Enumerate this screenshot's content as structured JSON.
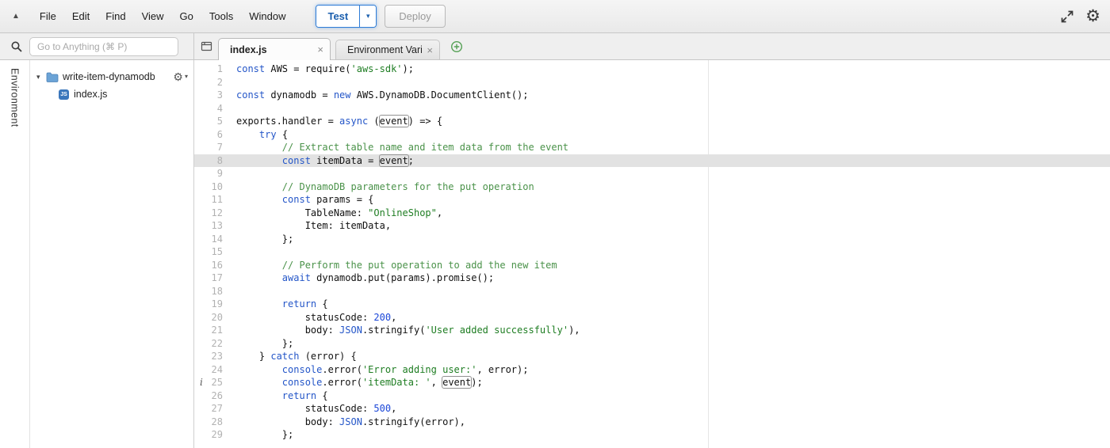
{
  "menubar": {
    "items": [
      "File",
      "Edit",
      "Find",
      "View",
      "Go",
      "Tools",
      "Window"
    ],
    "test_button": "Test",
    "deploy_button": "Deploy"
  },
  "searchbar": {
    "placeholder": "Go to Anything (⌘ P)"
  },
  "tabs": [
    {
      "label": "index.js",
      "active": true
    },
    {
      "label": "Environment Vari",
      "active": false
    }
  ],
  "sidebar": {
    "panel_label": "Environment",
    "folder": {
      "name": "write-item-dynamodb"
    },
    "files": [
      {
        "name": "index.js"
      }
    ]
  },
  "colors": {
    "accent-blue": "#2e7cd6",
    "keyword": "#2456c8",
    "string": "#1e7d22",
    "comment": "#4a9249",
    "number": "#1a46d8",
    "builtin": "#2456c8",
    "plus-green": "#55a055"
  },
  "editor": {
    "active_line": 8,
    "info_line": 25,
    "lines": [
      {
        "n": 1,
        "t": [
          [
            "k",
            "const"
          ],
          [
            "p",
            " AWS = require("
          ],
          [
            "s",
            "'aws-sdk'"
          ],
          [
            "p",
            ");"
          ]
        ]
      },
      {
        "n": 2,
        "t": []
      },
      {
        "n": 3,
        "t": [
          [
            "k",
            "const"
          ],
          [
            "p",
            " dynamodb = "
          ],
          [
            "k",
            "new"
          ],
          [
            "p",
            " AWS.DynamoDB.DocumentClient();"
          ]
        ]
      },
      {
        "n": 4,
        "t": []
      },
      {
        "n": 5,
        "t": [
          [
            "p",
            "exports.handler = "
          ],
          [
            "k",
            "async"
          ],
          [
            "p",
            " ("
          ],
          [
            "e",
            "event"
          ],
          [
            "p",
            ") => {"
          ]
        ]
      },
      {
        "n": 6,
        "t": [
          [
            "p",
            "    "
          ],
          [
            "k",
            "try"
          ],
          [
            "p",
            " {"
          ]
        ]
      },
      {
        "n": 7,
        "t": [
          [
            "p",
            "        "
          ],
          [
            "c",
            "// Extract table name and item data from the event"
          ]
        ]
      },
      {
        "n": 8,
        "t": [
          [
            "p",
            "        "
          ],
          [
            "k",
            "const"
          ],
          [
            "p",
            " itemData = "
          ],
          [
            "e",
            "event"
          ],
          [
            "p",
            ";"
          ]
        ]
      },
      {
        "n": 9,
        "t": []
      },
      {
        "n": 10,
        "t": [
          [
            "p",
            "        "
          ],
          [
            "c",
            "// DynamoDB parameters for the put operation"
          ]
        ]
      },
      {
        "n": 11,
        "t": [
          [
            "p",
            "        "
          ],
          [
            "k",
            "const"
          ],
          [
            "p",
            " params = {"
          ]
        ]
      },
      {
        "n": 12,
        "t": [
          [
            "p",
            "            TableName: "
          ],
          [
            "s",
            "\"OnlineShop\""
          ],
          [
            "p",
            ","
          ]
        ]
      },
      {
        "n": 13,
        "t": [
          [
            "p",
            "            Item: itemData,"
          ]
        ]
      },
      {
        "n": 14,
        "t": [
          [
            "p",
            "        };"
          ]
        ]
      },
      {
        "n": 15,
        "t": []
      },
      {
        "n": 16,
        "t": [
          [
            "p",
            "        "
          ],
          [
            "c",
            "// Perform the put operation to add the new item"
          ]
        ]
      },
      {
        "n": 17,
        "t": [
          [
            "p",
            "        "
          ],
          [
            "k",
            "await"
          ],
          [
            "p",
            " dynamodb.put(params).promise();"
          ]
        ]
      },
      {
        "n": 18,
        "t": []
      },
      {
        "n": 19,
        "t": [
          [
            "p",
            "        "
          ],
          [
            "k",
            "return"
          ],
          [
            "p",
            " {"
          ]
        ]
      },
      {
        "n": 20,
        "t": [
          [
            "p",
            "            statusCode: "
          ],
          [
            "n",
            "200"
          ],
          [
            "p",
            ","
          ]
        ]
      },
      {
        "n": 21,
        "t": [
          [
            "p",
            "            body: "
          ],
          [
            "b",
            "JSON"
          ],
          [
            "p",
            ".stringify("
          ],
          [
            "s",
            "'User added successfully'"
          ],
          [
            "p",
            "),"
          ]
        ]
      },
      {
        "n": 22,
        "t": [
          [
            "p",
            "        };"
          ]
        ]
      },
      {
        "n": 23,
        "t": [
          [
            "p",
            "    } "
          ],
          [
            "k",
            "catch"
          ],
          [
            "p",
            " (error) {"
          ]
        ]
      },
      {
        "n": 24,
        "t": [
          [
            "p",
            "        "
          ],
          [
            "b",
            "console"
          ],
          [
            "p",
            ".error("
          ],
          [
            "s",
            "'Error adding user:'"
          ],
          [
            "p",
            ", error);"
          ]
        ]
      },
      {
        "n": 25,
        "t": [
          [
            "p",
            "        "
          ],
          [
            "b",
            "console"
          ],
          [
            "p",
            ".error("
          ],
          [
            "s",
            "'itemData: '"
          ],
          [
            "p",
            ", "
          ],
          [
            "e",
            "event"
          ],
          [
            "p",
            ");"
          ]
        ]
      },
      {
        "n": 26,
        "t": [
          [
            "p",
            "        "
          ],
          [
            "k",
            "return"
          ],
          [
            "p",
            " {"
          ]
        ]
      },
      {
        "n": 27,
        "t": [
          [
            "p",
            "            statusCode: "
          ],
          [
            "n",
            "500"
          ],
          [
            "p",
            ","
          ]
        ]
      },
      {
        "n": 28,
        "t": [
          [
            "p",
            "            body: "
          ],
          [
            "b",
            "JSON"
          ],
          [
            "p",
            ".stringify(error),"
          ]
        ]
      },
      {
        "n": 29,
        "t": [
          [
            "p",
            "        };"
          ]
        ]
      }
    ]
  }
}
